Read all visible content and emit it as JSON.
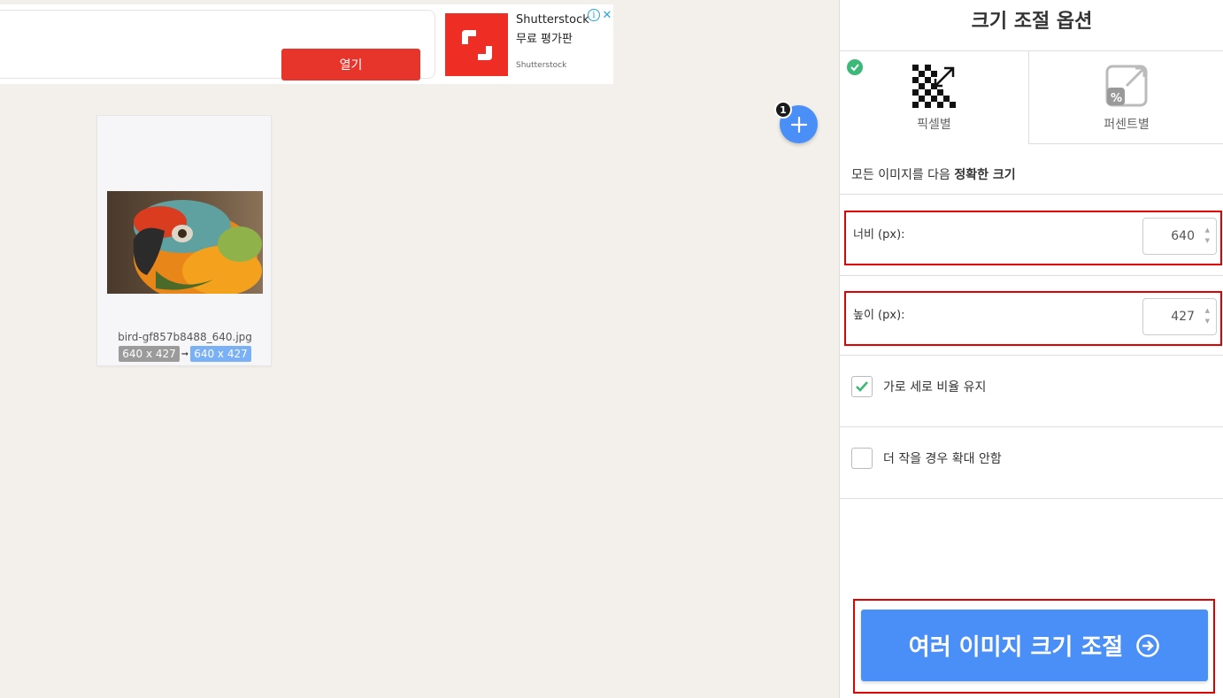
{
  "ad": {
    "open_label": "열기",
    "title": "Shutterstock",
    "subtitle": "무료 평가판",
    "brand": "Shutterstock",
    "info_glyph": "i",
    "close_glyph": "✕"
  },
  "add_button": {
    "badge_count": "1"
  },
  "file": {
    "name": "bird-gf857b8488_640.jpg",
    "original_size": "640 x 427",
    "new_size": "640 x 427",
    "arrow": "➞"
  },
  "sidebar": {
    "title": "크기 조절 옵션",
    "tabs": [
      {
        "label": "픽셀별",
        "active": true
      },
      {
        "label": "퍼센트별",
        "active": false
      }
    ],
    "description_prefix": "모든 이미지를 다음 ",
    "description_bold": "정확한 크기",
    "width": {
      "label": "너비 (px):",
      "value": "640"
    },
    "height": {
      "label": "높이 (px):",
      "value": "427"
    },
    "keep_aspect": {
      "label": "가로 세로 비율 유지",
      "checked": true
    },
    "no_enlarge": {
      "label": "더 작을 경우 확대 안함",
      "checked": false
    },
    "resize_button": "여러 이미지 크기 조절"
  },
  "colors": {
    "accent": "#4a8ff7",
    "ad_red": "#e8352c",
    "check_green": "#3cb878",
    "highlight_red": "#e00000"
  }
}
